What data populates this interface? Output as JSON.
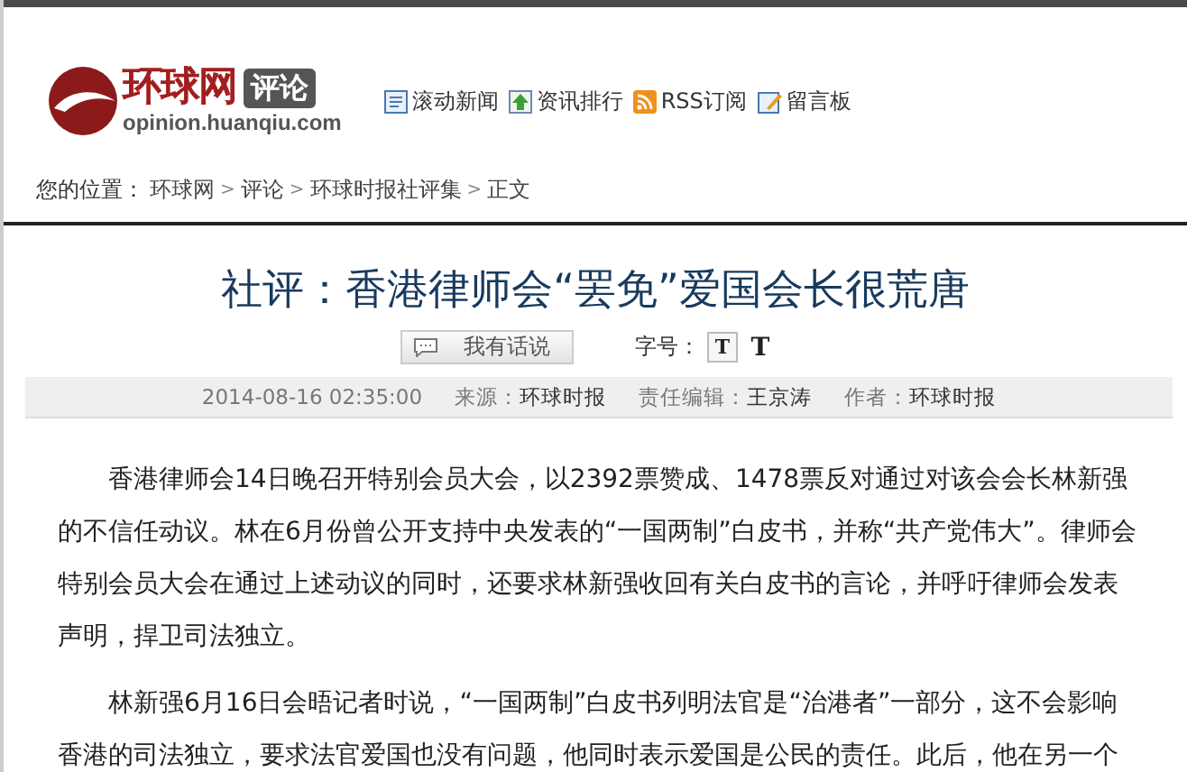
{
  "logo": {
    "name": "环球网",
    "section": "评论",
    "url": "opinion.huanqiu.com"
  },
  "top_links": [
    "滚动新闻",
    "资讯排行",
    "RSS订阅",
    "留言板"
  ],
  "breadcrumb": {
    "label": "您的位置：",
    "items": [
      "环球网",
      "评论",
      "环球时报社评集",
      "正文"
    ],
    "separator": ">"
  },
  "article": {
    "title": "社评：香港律师会“罢免”爱国会长很荒唐",
    "comment_button": "我有话说",
    "font_size_label": "字号：",
    "font_buttons": [
      {
        "label": "T",
        "selected": true
      },
      {
        "label": "T",
        "selected": false
      }
    ],
    "meta": {
      "date": "2014-08-16 02:35:00",
      "source_label": "来源：",
      "source": "环球时报",
      "editor_label": "责任编辑：",
      "editor": "王京涛",
      "author_label": "作者：",
      "author": "环球时报"
    },
    "paragraphs": [
      "香港律师会14日晚召开特别会员大会，以2392票赞成、1478票反对通过对该会会长林新强的不信任动议。林在6月份曾公开支持中央发表的“一国两制”白皮书，并称“共产党伟大”。律师会特别会员大会在通过上述动议的同时，还要求林新强收回有关白皮书的言论，并呼吁律师会发表声明，捍卫司法独立。",
      "林新强6月16日会晤记者时说，“一国两制”白皮书列明法官是“治港者”一部分，这不会影响香港的司法独立，要求法官爱国也没有问题，他同时表示爱国是公民的责任。此后，他在另一个"
    ]
  }
}
